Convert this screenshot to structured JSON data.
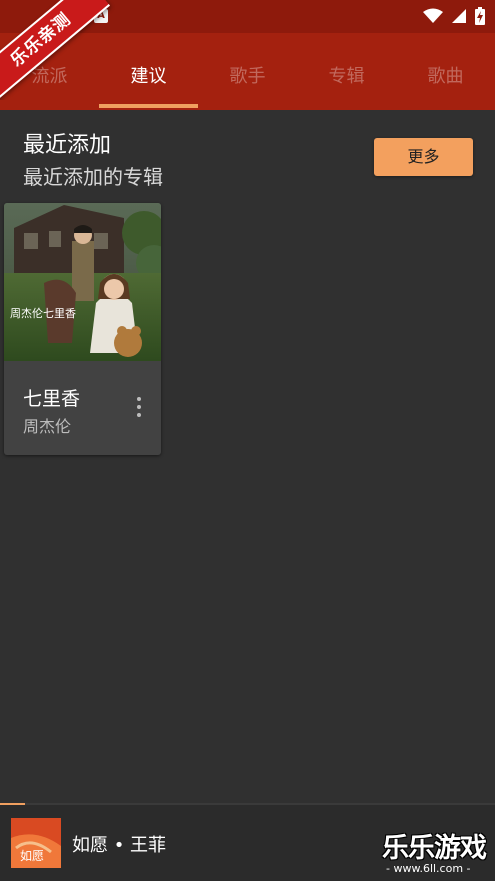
{
  "status_bar": {
    "notification_glyph": "A",
    "icons": [
      "wifi-icon",
      "cellular-signal-icon",
      "battery-charging-icon"
    ]
  },
  "watermark_ribbon": "乐乐亲测",
  "tabs": [
    {
      "label": "流派",
      "active": false
    },
    {
      "label": "建议",
      "active": true
    },
    {
      "label": "歌手",
      "active": false
    },
    {
      "label": "专辑",
      "active": false
    },
    {
      "label": "歌曲",
      "active": false
    }
  ],
  "section": {
    "title": "最近添加",
    "subtitle": "最近添加的专辑",
    "more_label": "更多"
  },
  "albums": [
    {
      "title": "七里香",
      "artist": "周杰伦",
      "cover_text": "周杰伦七里香"
    }
  ],
  "mini_player": {
    "now_playing": "如愿 • 王菲",
    "progress": 0.05,
    "cover_text": "如愿"
  },
  "watermark": {
    "brand": "乐乐游戏",
    "url": "- www.6ll.com -"
  },
  "colors": {
    "status_bar": "#8e1a0c",
    "tab_bar": "#a4210f",
    "accent": "#f0a060",
    "background": "#303030",
    "card": "#424242"
  }
}
